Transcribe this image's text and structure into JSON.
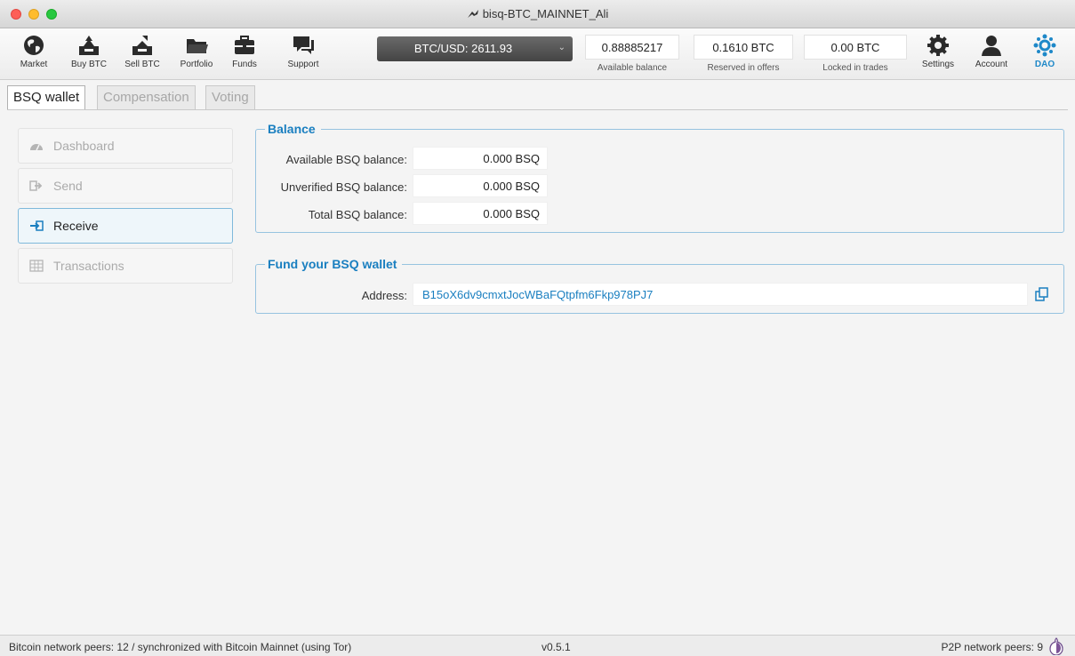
{
  "window": {
    "title": "bisq-BTC_MAINNET_Ali"
  },
  "toolbar": {
    "nav": [
      {
        "label": "Market",
        "icon": "globe-icon"
      },
      {
        "label": "Buy BTC",
        "icon": "buy-btc-icon"
      },
      {
        "label": "Sell BTC",
        "icon": "sell-btc-icon"
      },
      {
        "label": "Portfolio",
        "icon": "folder-icon"
      },
      {
        "label": "Funds",
        "icon": "briefcase-icon"
      },
      {
        "label": "Support",
        "icon": "chat-icon"
      }
    ],
    "price": {
      "label": "BTC/USD: 2611.93"
    },
    "balances": [
      {
        "value": "0.88885217",
        "caption": "Available balance"
      },
      {
        "value": "0.1610 BTC",
        "caption": "Reserved in offers"
      },
      {
        "value": "0.00 BTC",
        "caption": "Locked in trades"
      }
    ],
    "right_nav": [
      {
        "label": "Settings",
        "icon": "gear-icon"
      },
      {
        "label": "Account",
        "icon": "user-icon"
      },
      {
        "label": "DAO",
        "icon": "dao-icon"
      }
    ]
  },
  "tabs": [
    {
      "label": "BSQ wallet",
      "active": true
    },
    {
      "label": "Compensation",
      "active": false
    },
    {
      "label": "Voting",
      "active": false
    }
  ],
  "sidebar": {
    "items": [
      {
        "label": "Dashboard",
        "icon": "dashboard-icon",
        "active": false
      },
      {
        "label": "Send",
        "icon": "send-icon",
        "active": false
      },
      {
        "label": "Receive",
        "icon": "receive-icon",
        "active": true
      },
      {
        "label": "Transactions",
        "icon": "table-icon",
        "active": false
      }
    ]
  },
  "balance": {
    "title": "Balance",
    "rows": [
      {
        "label": "Available BSQ balance:",
        "value": "0.000 BSQ"
      },
      {
        "label": "Unverified BSQ balance:",
        "value": "0.000 BSQ"
      },
      {
        "label": "Total BSQ balance:",
        "value": "0.000 BSQ"
      }
    ]
  },
  "fund": {
    "title": "Fund your BSQ wallet",
    "address_label": "Address:",
    "address": "B15oX6dv9cmxtJocWBaFQtpfm6Fkp978PJ7"
  },
  "status": {
    "left": "Bitcoin network peers: 12 / synchronized with Bitcoin Mainnet (using Tor)",
    "version": "v0.5.1",
    "right": "P2P network peers: 9"
  },
  "colors": {
    "accent": "#1a7fc0",
    "dao": "#1e88c8",
    "border": "#96c3e0"
  }
}
